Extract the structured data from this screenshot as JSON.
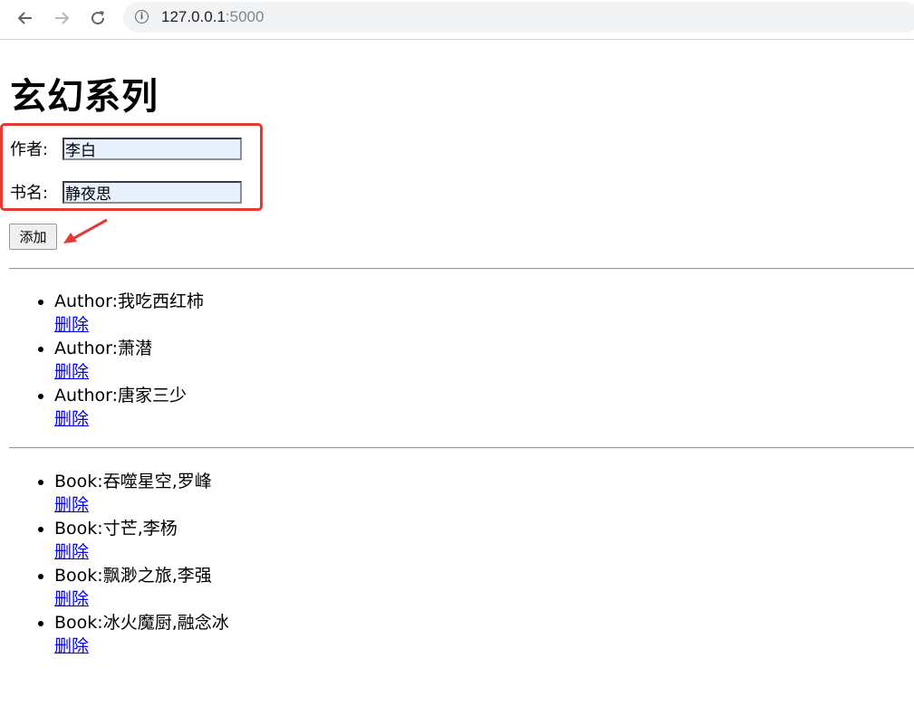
{
  "browser": {
    "url_host": "127.0.0.1",
    "url_port": ":5000"
  },
  "page": {
    "title": "玄幻系列"
  },
  "form": {
    "author_label": "作者:",
    "author_value": "李白",
    "book_label": "书名:",
    "book_value": "静夜思",
    "add_button": "添加"
  },
  "authors": [
    {
      "text": "Author:我吃西红柿",
      "delete": "删除"
    },
    {
      "text": "Author:萧潜",
      "delete": "删除"
    },
    {
      "text": "Author:唐家三少",
      "delete": "删除"
    }
  ],
  "books": [
    {
      "text": "Book:吞噬星空,罗峰",
      "delete": "删除"
    },
    {
      "text": "Book:寸芒,李杨",
      "delete": "删除"
    },
    {
      "text": "Book:飘渺之旅,李强",
      "delete": "删除"
    },
    {
      "text": "Book:冰火魔厨,融念冰",
      "delete": "删除"
    }
  ],
  "colors": {
    "highlight_box": "#e53935",
    "link": "#0000ee",
    "autofill_bg": "#e8f0fe"
  },
  "icons": [
    "back-arrow-icon",
    "forward-arrow-icon",
    "reload-icon",
    "info-icon"
  ]
}
